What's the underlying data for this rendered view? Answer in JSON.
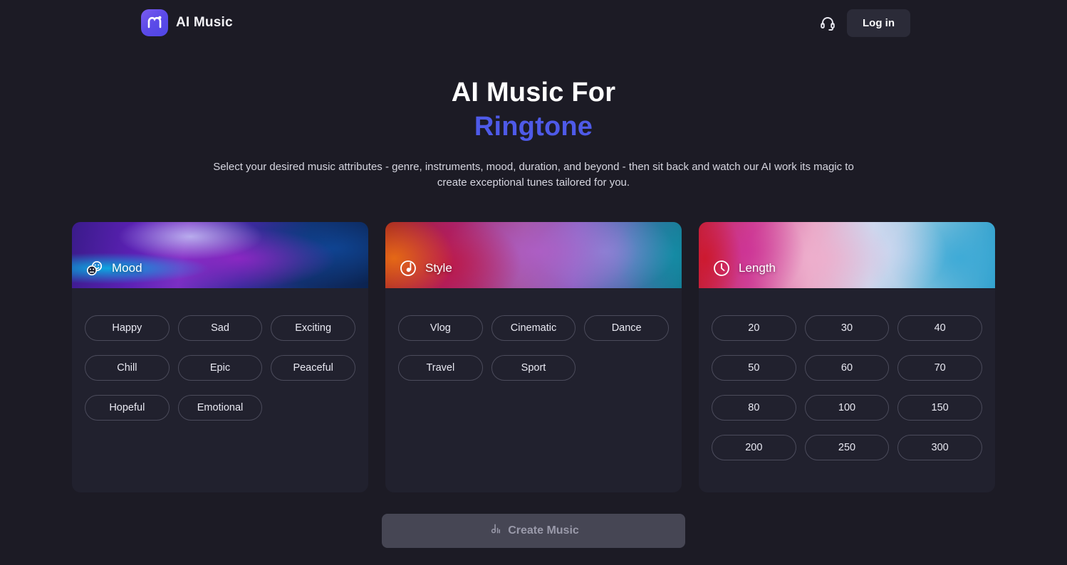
{
  "header": {
    "brand_name": "AI Music",
    "logo_icon": "ai-music-logo",
    "support_icon": "headset-icon",
    "login_label": "Log in"
  },
  "hero": {
    "title_line1": "AI Music For",
    "title_line2": "Ringtone",
    "accent_color": "#4e5ae8",
    "subtitle": "Select your desired music attributes - genre, instruments, mood, duration, and beyond - then sit back and watch our AI work its magic to create exceptional tunes tailored for you."
  },
  "cards": [
    {
      "id": "mood",
      "title": "Mood",
      "icon": "smiley-faces-icon",
      "options": [
        "Happy",
        "Sad",
        "Exciting",
        "Chill",
        "Epic",
        "Peaceful",
        "Hopeful",
        "Emotional"
      ]
    },
    {
      "id": "style",
      "title": "Style",
      "icon": "music-note-circle-icon",
      "options": [
        "Vlog",
        "Cinematic",
        "Dance",
        "Travel",
        "Sport"
      ]
    },
    {
      "id": "length",
      "title": "Length",
      "icon": "clock-icon",
      "options": [
        "20",
        "30",
        "40",
        "50",
        "60",
        "70",
        "80",
        "100",
        "150",
        "200",
        "250",
        "300"
      ]
    }
  ],
  "cta": {
    "label": "Create Music",
    "icon": "music-bars-icon",
    "disabled": true
  },
  "theme": {
    "page_bg": "#1c1b25",
    "card_bg": "#21212e",
    "chip_border": "#4b4b5b",
    "cta_bg": "#464654",
    "cta_text": "#9a9aaa"
  }
}
